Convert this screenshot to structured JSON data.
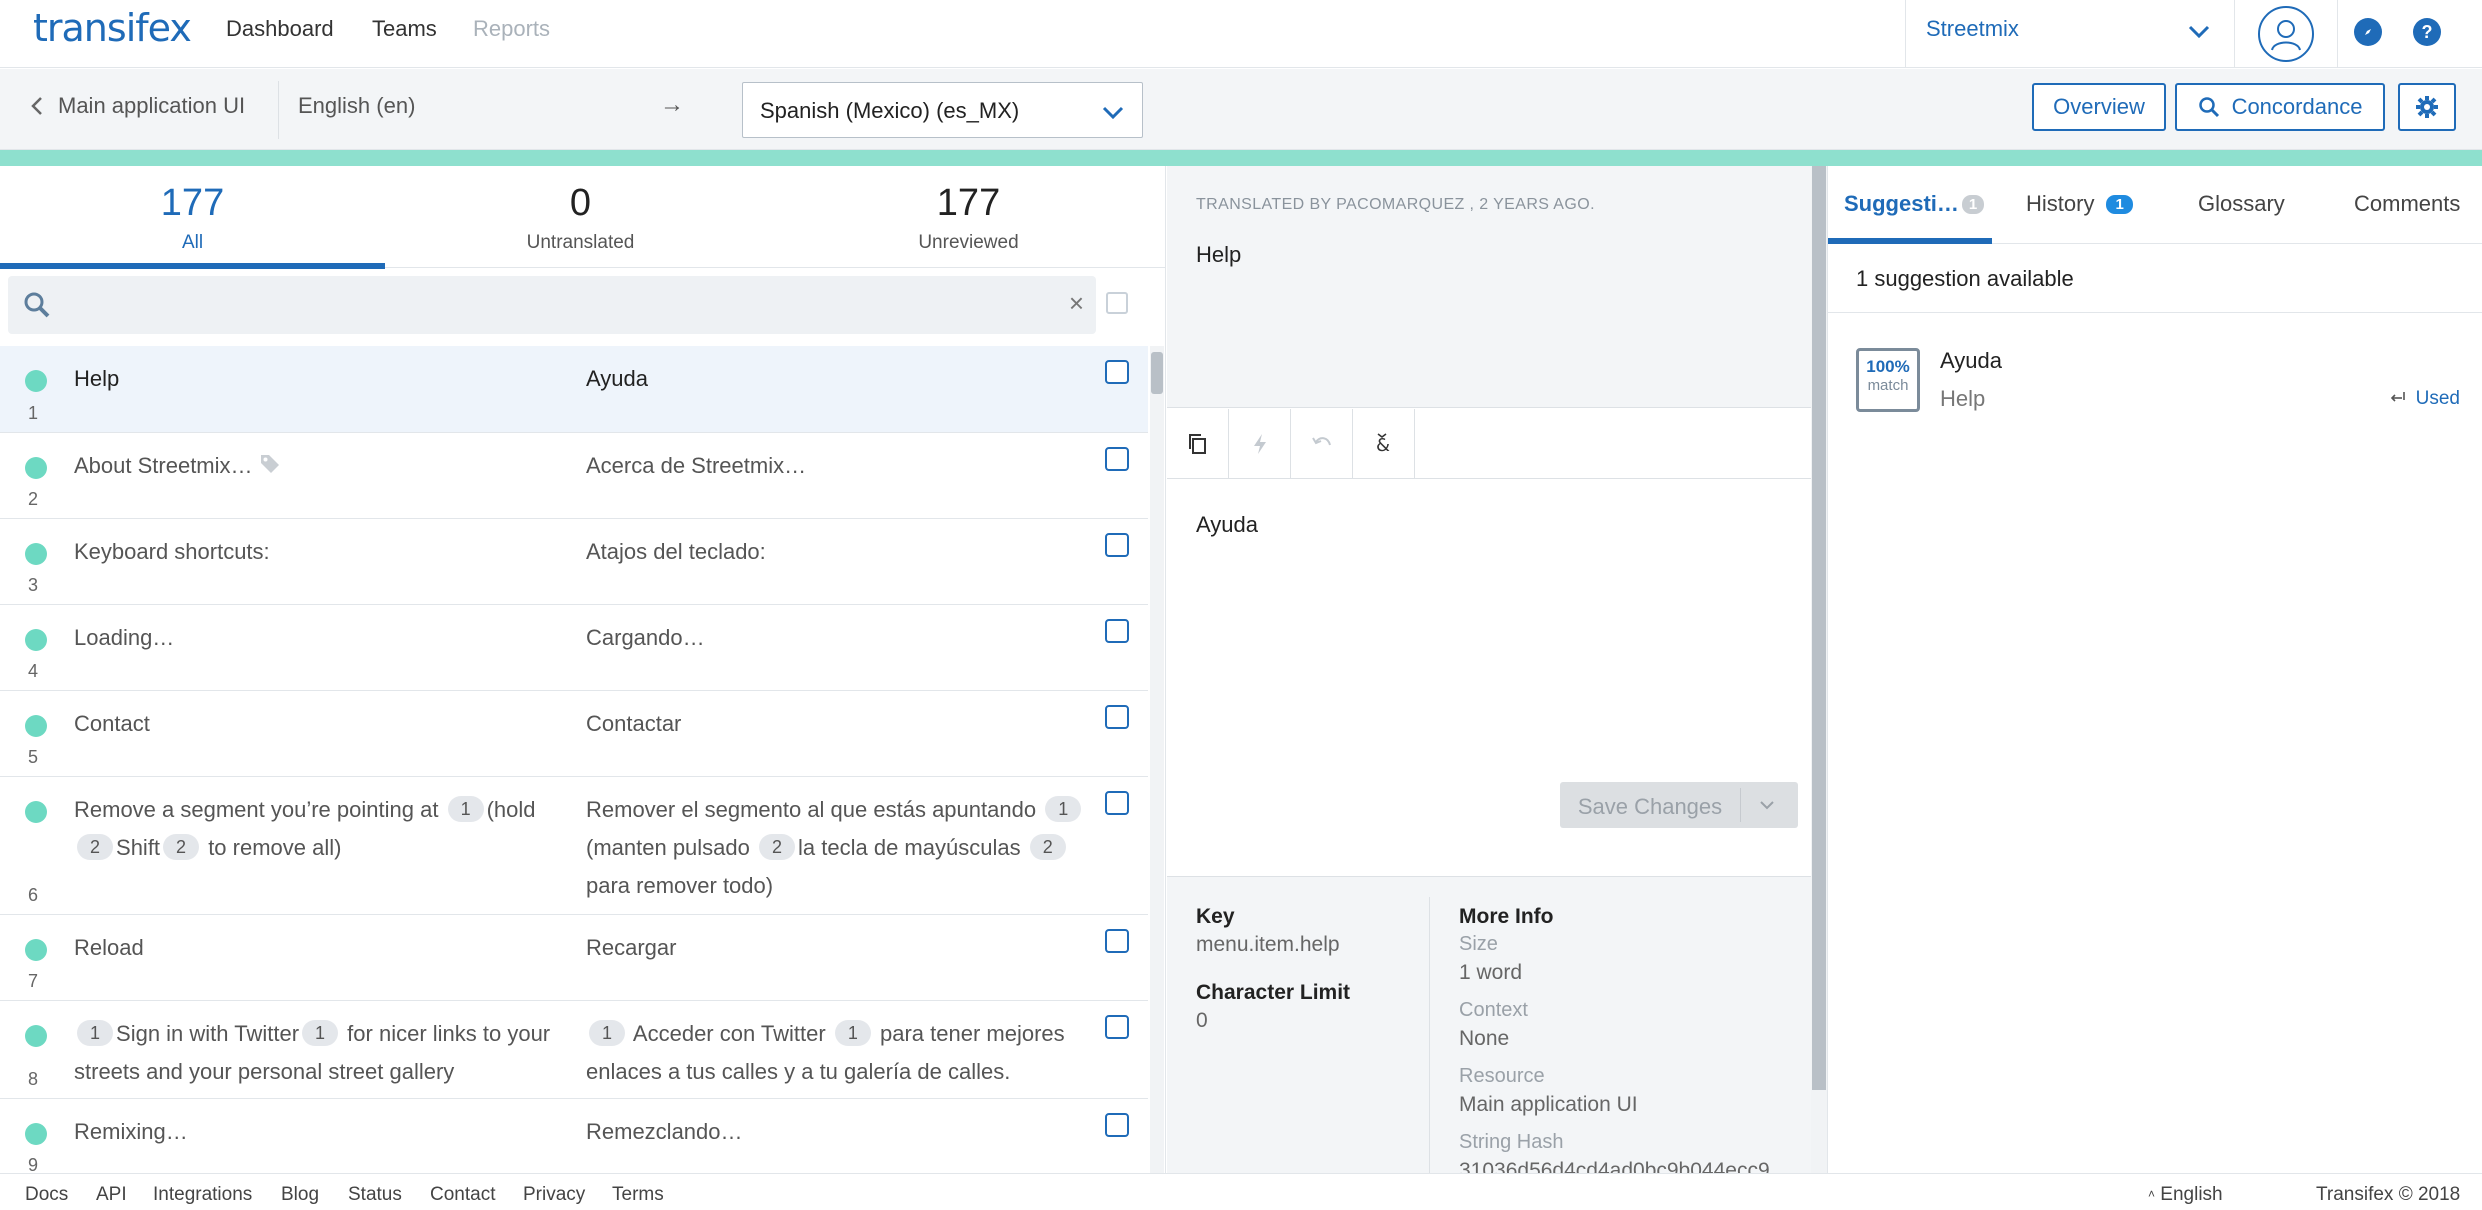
{
  "app": {
    "logo": "transifex",
    "nav": [
      "Dashboard",
      "Teams",
      "Reports"
    ],
    "org": "Streetmix"
  },
  "subbar": {
    "back": "Main application UI",
    "source_lang": "English (en)",
    "arrow": "→",
    "target_lang": "Spanish (Mexico) (es_MX)",
    "overview": "Overview",
    "concordance": "Concordance"
  },
  "stats": [
    {
      "num": "177",
      "label": "All"
    },
    {
      "num": "0",
      "label": "Untranslated"
    },
    {
      "num": "177",
      "label": "Unreviewed"
    }
  ],
  "search": {
    "placeholder": "",
    "clear": "×"
  },
  "rows": [
    {
      "num": "1",
      "src": "Help",
      "tgt": "Ayuda"
    },
    {
      "num": "2",
      "src": "About Streetmix…",
      "tgt": "Acerca de Streetmix…"
    },
    {
      "num": "3",
      "src": "Keyboard shortcuts:",
      "tgt": "Atajos del teclado:"
    },
    {
      "num": "4",
      "src": "Loading…",
      "tgt": "Cargando…"
    },
    {
      "num": "5",
      "src": "Contact",
      "tgt": "Contactar"
    },
    {
      "num": "6",
      "src_parts": [
        "Remove a segment you’re pointing at",
        "1",
        "(hold",
        "2",
        "Shift",
        "2",
        "to remove all)"
      ],
      "tgt_parts": [
        "Remover el segmento al que estás apuntando",
        "1",
        "(manten pulsado",
        "2",
        "la tecla de mayúsculas",
        "2",
        "para remover todo)"
      ]
    },
    {
      "num": "7",
      "src": "Reload",
      "tgt": "Recargar"
    },
    {
      "num": "8",
      "src_parts": [
        "1",
        "Sign in with Twitter",
        "1",
        "for nicer links to your streets and your personal street gallery"
      ],
      "tgt_parts": [
        "1",
        "Acceder con Twitter",
        "1",
        "para tener mejores enlaces a tus calles y a tu galería de calles."
      ]
    },
    {
      "num": "9",
      "src": "Remixing…",
      "tgt": "Remezclando…"
    }
  ],
  "editor": {
    "meta": "TRANSLATED BY PACOMARQUEZ , 2 YEARS AGO.",
    "source": "Help",
    "translation": "Ayuda",
    "save": "Save Changes"
  },
  "info": {
    "key_label": "Key",
    "key": "menu.item.help",
    "limit_label": "Character Limit",
    "limit": "0",
    "more_label": "More Info",
    "size_label": "Size",
    "size": "1 word",
    "context_label": "Context",
    "context": "None",
    "resource_label": "Resource",
    "resource": "Main application UI",
    "hash_label": "String Hash",
    "hash": "31036d56d4cd4ad0bc9b044ecc9"
  },
  "right": {
    "tabs": [
      {
        "label": "Suggesti…",
        "badge": "1"
      },
      {
        "label": "History",
        "badge": "1"
      },
      {
        "label": "Glossary"
      },
      {
        "label": "Comments"
      }
    ],
    "available": "1 suggestion available",
    "suggestion": {
      "pct": "100%",
      "match": "match",
      "target": "Ayuda",
      "source": "Help",
      "used": "Used"
    }
  },
  "footer": {
    "links": [
      "Docs",
      "API",
      "Integrations",
      "Blog",
      "Status",
      "Contact",
      "Privacy",
      "Terms"
    ],
    "language": "English",
    "copyright": "Transifex © 2018"
  },
  "colors": {
    "brand": "#1f6bb8",
    "progress": "#8ee0ce",
    "status_dot": "#6dd9c2"
  }
}
